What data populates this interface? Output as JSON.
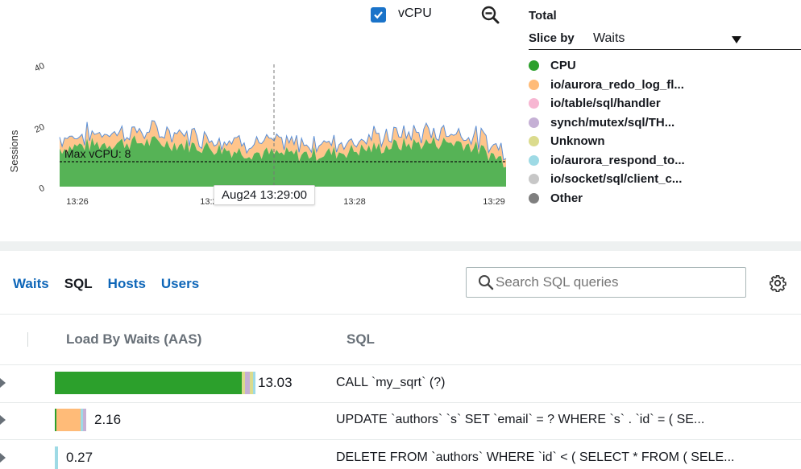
{
  "toolbar": {
    "vcpu_label": "vCPU",
    "vcpu_checked": true
  },
  "legend": {
    "total_label": "Total",
    "slice_by_label": "Slice by",
    "slice_by_value": "Waits",
    "items": [
      {
        "label": "CPU",
        "color": "#2ca02c"
      },
      {
        "label": "io/aurora_redo_log_fl...",
        "color": "#ffbb78"
      },
      {
        "label": "io/table/sql/handler",
        "color": "#f7b6d2"
      },
      {
        "label": "synch/mutex/sql/TH...",
        "color": "#c5b0d5"
      },
      {
        "label": "Unknown",
        "color": "#dbdb8d"
      },
      {
        "label": "io/aurora_respond_to...",
        "color": "#9edae5"
      },
      {
        "label": "io/socket/sql/client_c...",
        "color": "#c7c7c7"
      },
      {
        "label": "Other",
        "color": "#7f7f7f"
      }
    ]
  },
  "chart_data": {
    "type": "area",
    "ylabel": "Sessions",
    "y_ticks": [
      "0",
      "20",
      "40"
    ],
    "ylim": [
      0,
      40
    ],
    "x_ticks": [
      "13:26",
      "13:27",
      "13:28",
      "13:29"
    ],
    "max_vcpu_label": "Max vCPU: 8",
    "max_vcpu_value": 8,
    "tooltip": "Aug24 13:29:00",
    "series": [
      {
        "name": "CPU",
        "color": "#2ca02c",
        "description": "roughly 10–14 sessions throughout, dropping near 13:29"
      },
      {
        "name": "io/aurora_redo_log_fl...",
        "color": "#ffbb78",
        "description": "thin band of ~2–5 sessions on top"
      }
    ]
  },
  "tabs": [
    {
      "label": "Waits",
      "active": false
    },
    {
      "label": "SQL",
      "active": true
    },
    {
      "label": "Hosts",
      "active": false
    },
    {
      "label": "Users",
      "active": false
    }
  ],
  "search": {
    "placeholder": "Search SQL queries"
  },
  "table": {
    "columns": [
      "Load By Waits (AAS)",
      "SQL"
    ],
    "rows": [
      {
        "load": "13.03",
        "load_value": 13.03,
        "sql": "CALL `my_sqrt` (?)"
      },
      {
        "load": "2.16",
        "load_value": 2.16,
        "sql": "UPDATE `authors` `s` SET `email` = ? WHERE `s` . `id` = ( SE..."
      },
      {
        "load": "0.27",
        "load_value": 0.27,
        "sql": "DELETE FROM `authors` WHERE `id` < ( SELECT * FROM ( SELE..."
      }
    ]
  }
}
